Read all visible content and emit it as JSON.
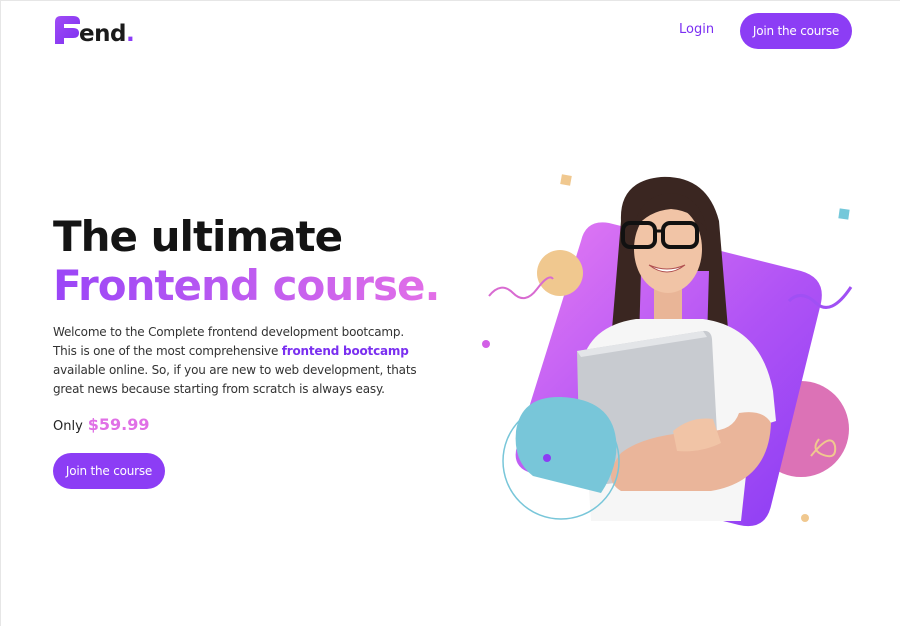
{
  "header": {
    "logo_text": "end",
    "logo_dot": ".",
    "login_label": "Login",
    "join_label": "Join the course"
  },
  "hero": {
    "title_line1": "The ultimate",
    "title_line2": "Frontend course.",
    "description_part1": "Welcome to the Complete frontend development bootcamp. This is one of the most comprehensive ",
    "description_highlight": "frontend bootcamp",
    "description_part2": " available online. So, if you are new to web development, thats great news because starting from scratch is always easy.",
    "price_label": "Only",
    "price_value": "$59.99",
    "cta_label": "Join the course"
  },
  "colors": {
    "brand_purple": "#8c3df5",
    "price_pink": "#e070e6",
    "gradient_start": "#9a45f7",
    "gradient_end": "#e36fe7"
  },
  "icons": {
    "logo_mark": "f-letter-mark",
    "illustration": "student-with-laptop"
  }
}
